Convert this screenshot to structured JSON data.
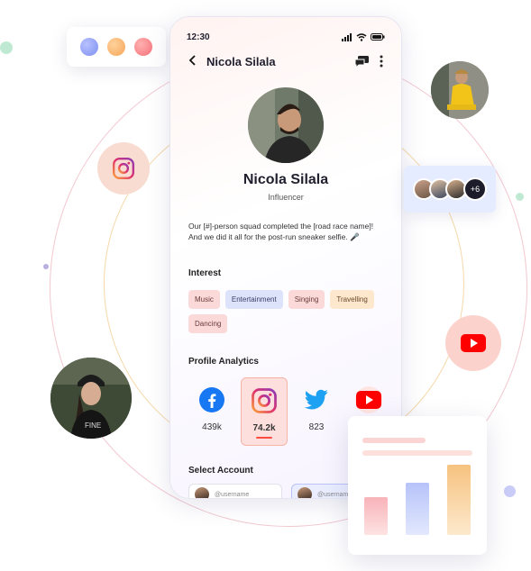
{
  "status_bar": {
    "time": "12:30"
  },
  "header": {
    "name": "Nicola Silala"
  },
  "profile": {
    "name": "Nicola Silala",
    "role": "Influencer",
    "bio": "Our [#]-person squad completed the [road race name]! And we did it all for the post-run sneaker selfie. 🎤"
  },
  "interest": {
    "title": "Interest",
    "tags": [
      {
        "label": "Music",
        "bg": "#fbd9d8",
        "color": "#6a3a3a"
      },
      {
        "label": "Entertainment",
        "bg": "#dde3fb",
        "color": "#3a3f6a"
      },
      {
        "label": "Singing",
        "bg": "#fbd9d8",
        "color": "#6a3a3a"
      },
      {
        "label": "Travelling",
        "bg": "#fde7cd",
        "color": "#6a4a2a"
      },
      {
        "label": "Dancing",
        "bg": "#fbd9d8",
        "color": "#6a3a3a"
      }
    ]
  },
  "analytics": {
    "title": "Profile Analytics",
    "items": [
      {
        "platform": "facebook",
        "icon": "facebook-icon",
        "value": "439k"
      },
      {
        "platform": "instagram",
        "icon": "instagram-icon",
        "value": "74.2k",
        "active": true
      },
      {
        "platform": "twitter",
        "icon": "twitter-icon",
        "value": "823"
      },
      {
        "platform": "youtube",
        "icon": "youtube-icon",
        "value": ""
      }
    ]
  },
  "accounts": {
    "title": "Select Account",
    "items": [
      {
        "handle": "@username"
      },
      {
        "handle": "@username"
      }
    ]
  },
  "group": {
    "more_count": "+6"
  },
  "colors": {
    "accent_red": "#ff3b30",
    "instagram": "#e1306c",
    "facebook": "#1877f2",
    "twitter": "#1da1f2",
    "youtube": "#ff0000"
  },
  "chart_preview": {
    "bars": [
      {
        "value": 0.42,
        "color_top": "#f8b3b8",
        "color_bottom": "#fde3e2"
      },
      {
        "value": 0.58,
        "color_top": "#b6c3fa",
        "color_bottom": "#e3e8fd"
      },
      {
        "value": 0.78,
        "color_top": "#f6c27f",
        "color_bottom": "#fde9cd"
      }
    ]
  }
}
